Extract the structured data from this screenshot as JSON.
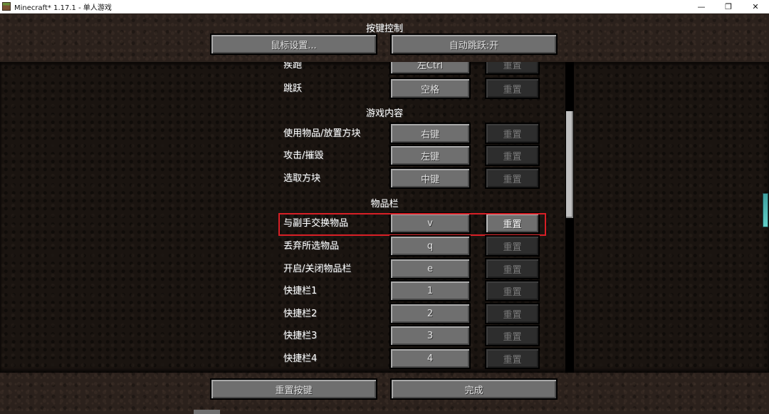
{
  "window": {
    "title": "Minecraft* 1.17.1 - 单人游戏",
    "minimize_glyph": "—",
    "maximize_glyph": "❐",
    "close_glyph": "✕"
  },
  "screen": {
    "title": "按键控制"
  },
  "top_buttons": {
    "mouse_settings": "鼠标设置...",
    "auto_jump": "自动跳跃:开"
  },
  "rows": {
    "sprint": {
      "label": "疾跑",
      "key": "左Ctrl",
      "reset": "重置"
    },
    "jump": {
      "label": "跳跃",
      "key": "空格",
      "reset": "重置"
    },
    "use_item": {
      "label": "使用物品/放置方块",
      "key": "右键",
      "reset": "重置"
    },
    "attack": {
      "label": "攻击/摧毁",
      "key": "左键",
      "reset": "重置"
    },
    "pick_block": {
      "label": "选取方块",
      "key": "中键",
      "reset": "重置"
    },
    "swap_offhand": {
      "label": "与副手交换物品",
      "key": "v",
      "reset": "重置"
    },
    "drop": {
      "label": "丢弃所选物品",
      "key": "q",
      "reset": "重置"
    },
    "inventory": {
      "label": "开启/关闭物品栏",
      "key": "e",
      "reset": "重置"
    },
    "hotbar1": {
      "label": "快捷栏1",
      "key": "1",
      "reset": "重置"
    },
    "hotbar2": {
      "label": "快捷栏2",
      "key": "2",
      "reset": "重置"
    },
    "hotbar3": {
      "label": "快捷栏3",
      "key": "3",
      "reset": "重置"
    },
    "hotbar4": {
      "label": "快捷栏4",
      "key": "4",
      "reset": "重置"
    }
  },
  "categories": {
    "gameplay": "游戏内容",
    "inventory": "物品栏"
  },
  "bottom_buttons": {
    "reset_keys": "重置按键",
    "done": "完成"
  },
  "colors": {
    "highlight_border": "#d81f26",
    "button_face": "#6f6f6f",
    "button_disabled": "#2d2d2d"
  }
}
